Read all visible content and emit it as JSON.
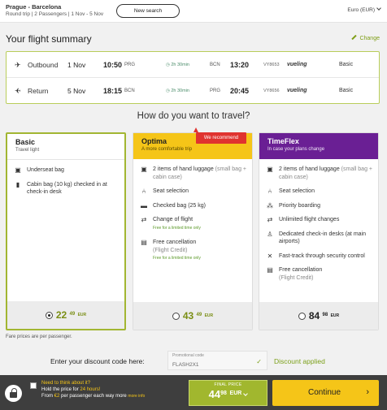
{
  "header": {
    "route": "Prague - Barcelona",
    "details": "Round trip | 2 Passengers | 1 Nov - 5 Nov",
    "new_search": "New search",
    "currency": "Euro (EUR)"
  },
  "summary": {
    "title": "Your flight summary",
    "change": "Change",
    "flights": [
      {
        "direction": "Outbound",
        "date": "1 Nov",
        "dep_time": "10:50",
        "dep_code": "PRG",
        "duration": "2h 30min",
        "arr_code": "BCN",
        "arr_time": "13:20",
        "flight_no": "VY8653",
        "carrier": "vueling",
        "fare": "Basic"
      },
      {
        "direction": "Return",
        "date": "5 Nov",
        "dep_time": "18:15",
        "dep_code": "BCN",
        "duration": "2h 30min",
        "arr_code": "PRG",
        "arr_time": "20:45",
        "flight_no": "VY8656",
        "carrier": "vueling",
        "fare": "Basic"
      }
    ]
  },
  "question": "How do you want to travel?",
  "fares": [
    {
      "name": "Basic",
      "tagline": "Travel light",
      "selected": true,
      "features": [
        {
          "icon": "bag-icon",
          "text": "Underseat bag"
        },
        {
          "icon": "cabin-bag-icon",
          "text": "Cabin bag (10 kg) checked in at check-in desk"
        }
      ],
      "price": {
        "whole": "22",
        "cents": "49",
        "currency": "EUR"
      }
    },
    {
      "name": "Optima",
      "tagline": "A more comfortable trip",
      "badge": "We recommend",
      "selected": false,
      "features": [
        {
          "icon": "luggage-icon",
          "text": "2 items of hand luggage",
          "sub": " (small bag + cabin case)"
        },
        {
          "icon": "seat-icon",
          "text": "Seat selection"
        },
        {
          "icon": "checked-bag-icon",
          "text": "Checked bag (25 kg)"
        },
        {
          "icon": "change-icon",
          "text": "Change of flight",
          "promo": "Free for a limited time only"
        },
        {
          "icon": "cancel-icon",
          "text": "Free cancellation",
          "sub": "(Flight Credit)",
          "promo": "Free for a limited time only"
        }
      ],
      "price": {
        "whole": "43",
        "cents": "49",
        "currency": "EUR"
      }
    },
    {
      "name": "TimeFlex",
      "tagline": "In case your plans change",
      "selected": false,
      "features": [
        {
          "icon": "luggage-icon",
          "text": "2 items of hand luggage",
          "sub": " (small bag + cabin case)"
        },
        {
          "icon": "seat-icon",
          "text": "Seat selection"
        },
        {
          "icon": "priority-icon",
          "text": "Priority boarding"
        },
        {
          "icon": "change-icon",
          "text": "Unlimited flight changes"
        },
        {
          "icon": "desk-icon",
          "text": "Dedicated check-in desks (at main airports)"
        },
        {
          "icon": "fasttrack-icon",
          "text": "Fast-track through security control"
        },
        {
          "icon": "cancel-icon",
          "text": "Free cancellation",
          "sub": "(Flight Credit)"
        }
      ],
      "price": {
        "whole": "84",
        "cents": "98",
        "currency": "EUR"
      }
    }
  ],
  "fare_note": "Fare prices are per passenger.",
  "discount": {
    "label": "Enter your discount code here:",
    "field_label": "Promotional code",
    "code": "FLASH2X1",
    "status": "Discount applied"
  },
  "footer": {
    "hold_title": "Need to think about it?",
    "hold_line1_a": "Hold the price for ",
    "hold_line1_b": "24 hours!",
    "hold_line2_a": "From ",
    "hold_line2_b": "€2",
    "hold_line2_c": " per passenger each way more ",
    "more_info": "more info",
    "final_label": "FINAL PRICE",
    "final_whole": "44",
    "final_cents": "98",
    "final_currency": "EUR",
    "continue": "Continue"
  },
  "colors": {
    "accent_green": "#a1b72e",
    "optima_yellow": "#f5c518",
    "timeflex_purple": "#6a1f94",
    "recommend_red": "#e0332f"
  }
}
